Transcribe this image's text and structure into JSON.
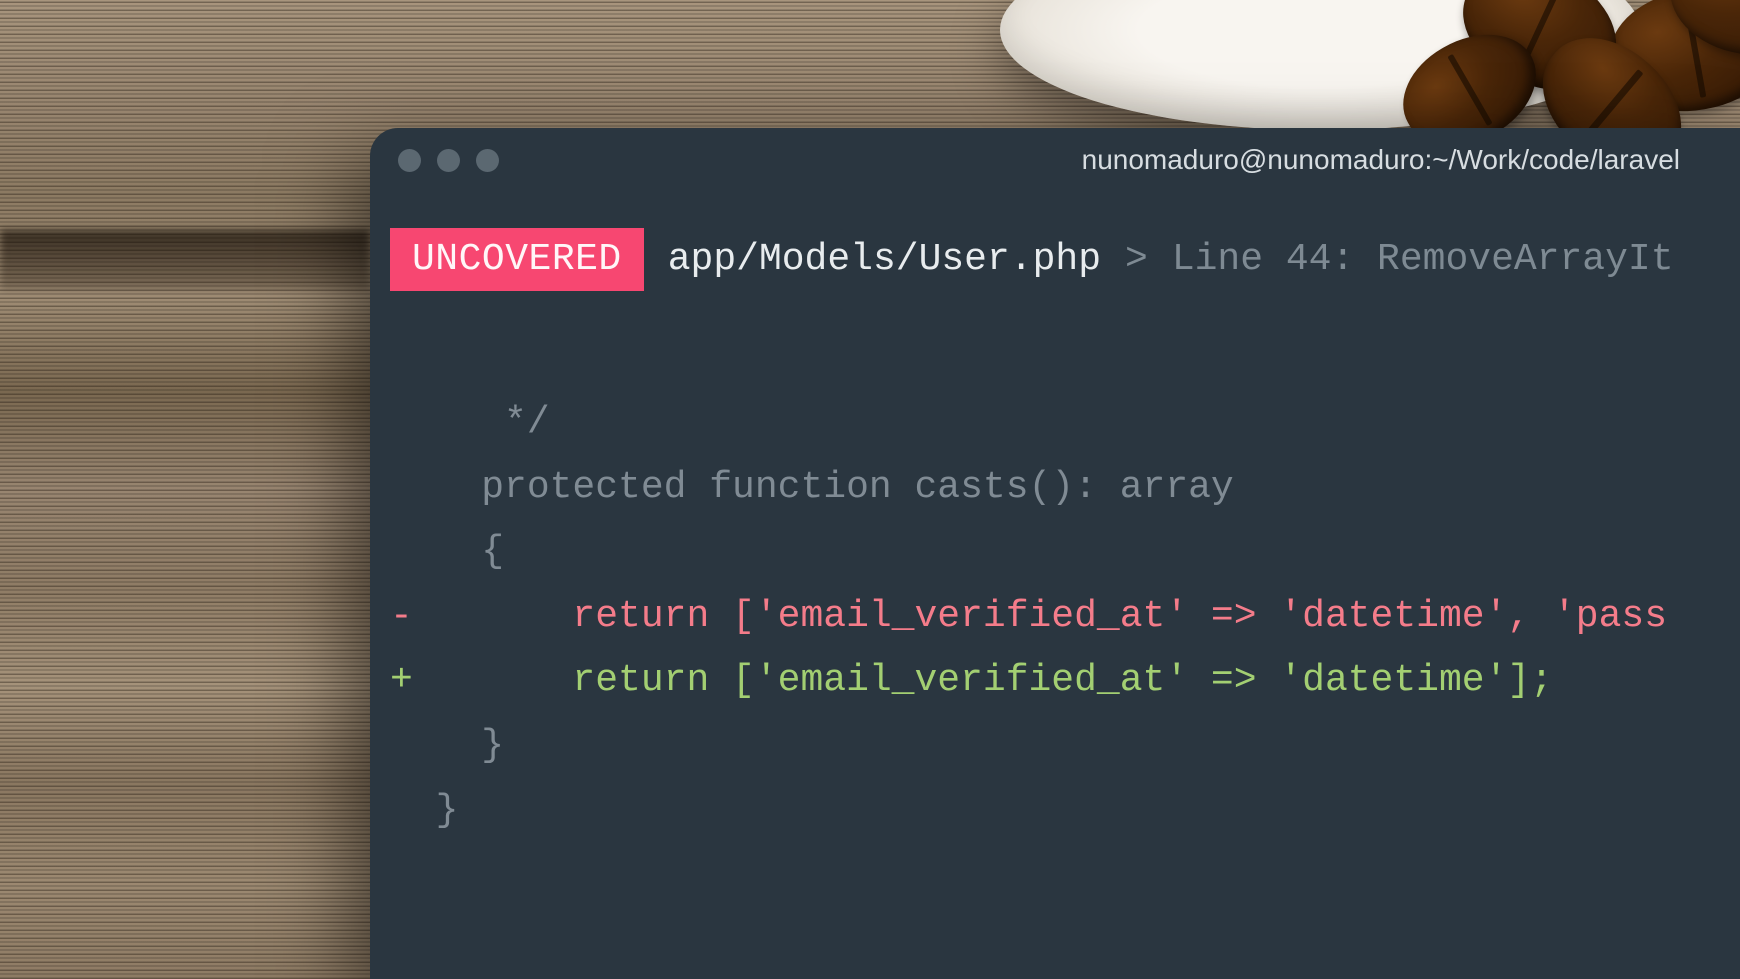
{
  "window": {
    "title": "nunomaduro@nunomaduro:~/Work/code/laravel"
  },
  "header": {
    "badge": "UNCOVERED",
    "file": "app/Models/User.php",
    "chevron": ">",
    "meta": "Line 44: RemoveArrayIt"
  },
  "code": {
    "l1": "     */",
    "l2": "    protected function casts(): array",
    "l3": "    {",
    "l4": "-       return ['email_verified_at' => 'datetime', 'pass",
    "l5": "+       return ['email_verified_at' => 'datetime'];",
    "l6": "    }",
    "l7": "  }"
  }
}
